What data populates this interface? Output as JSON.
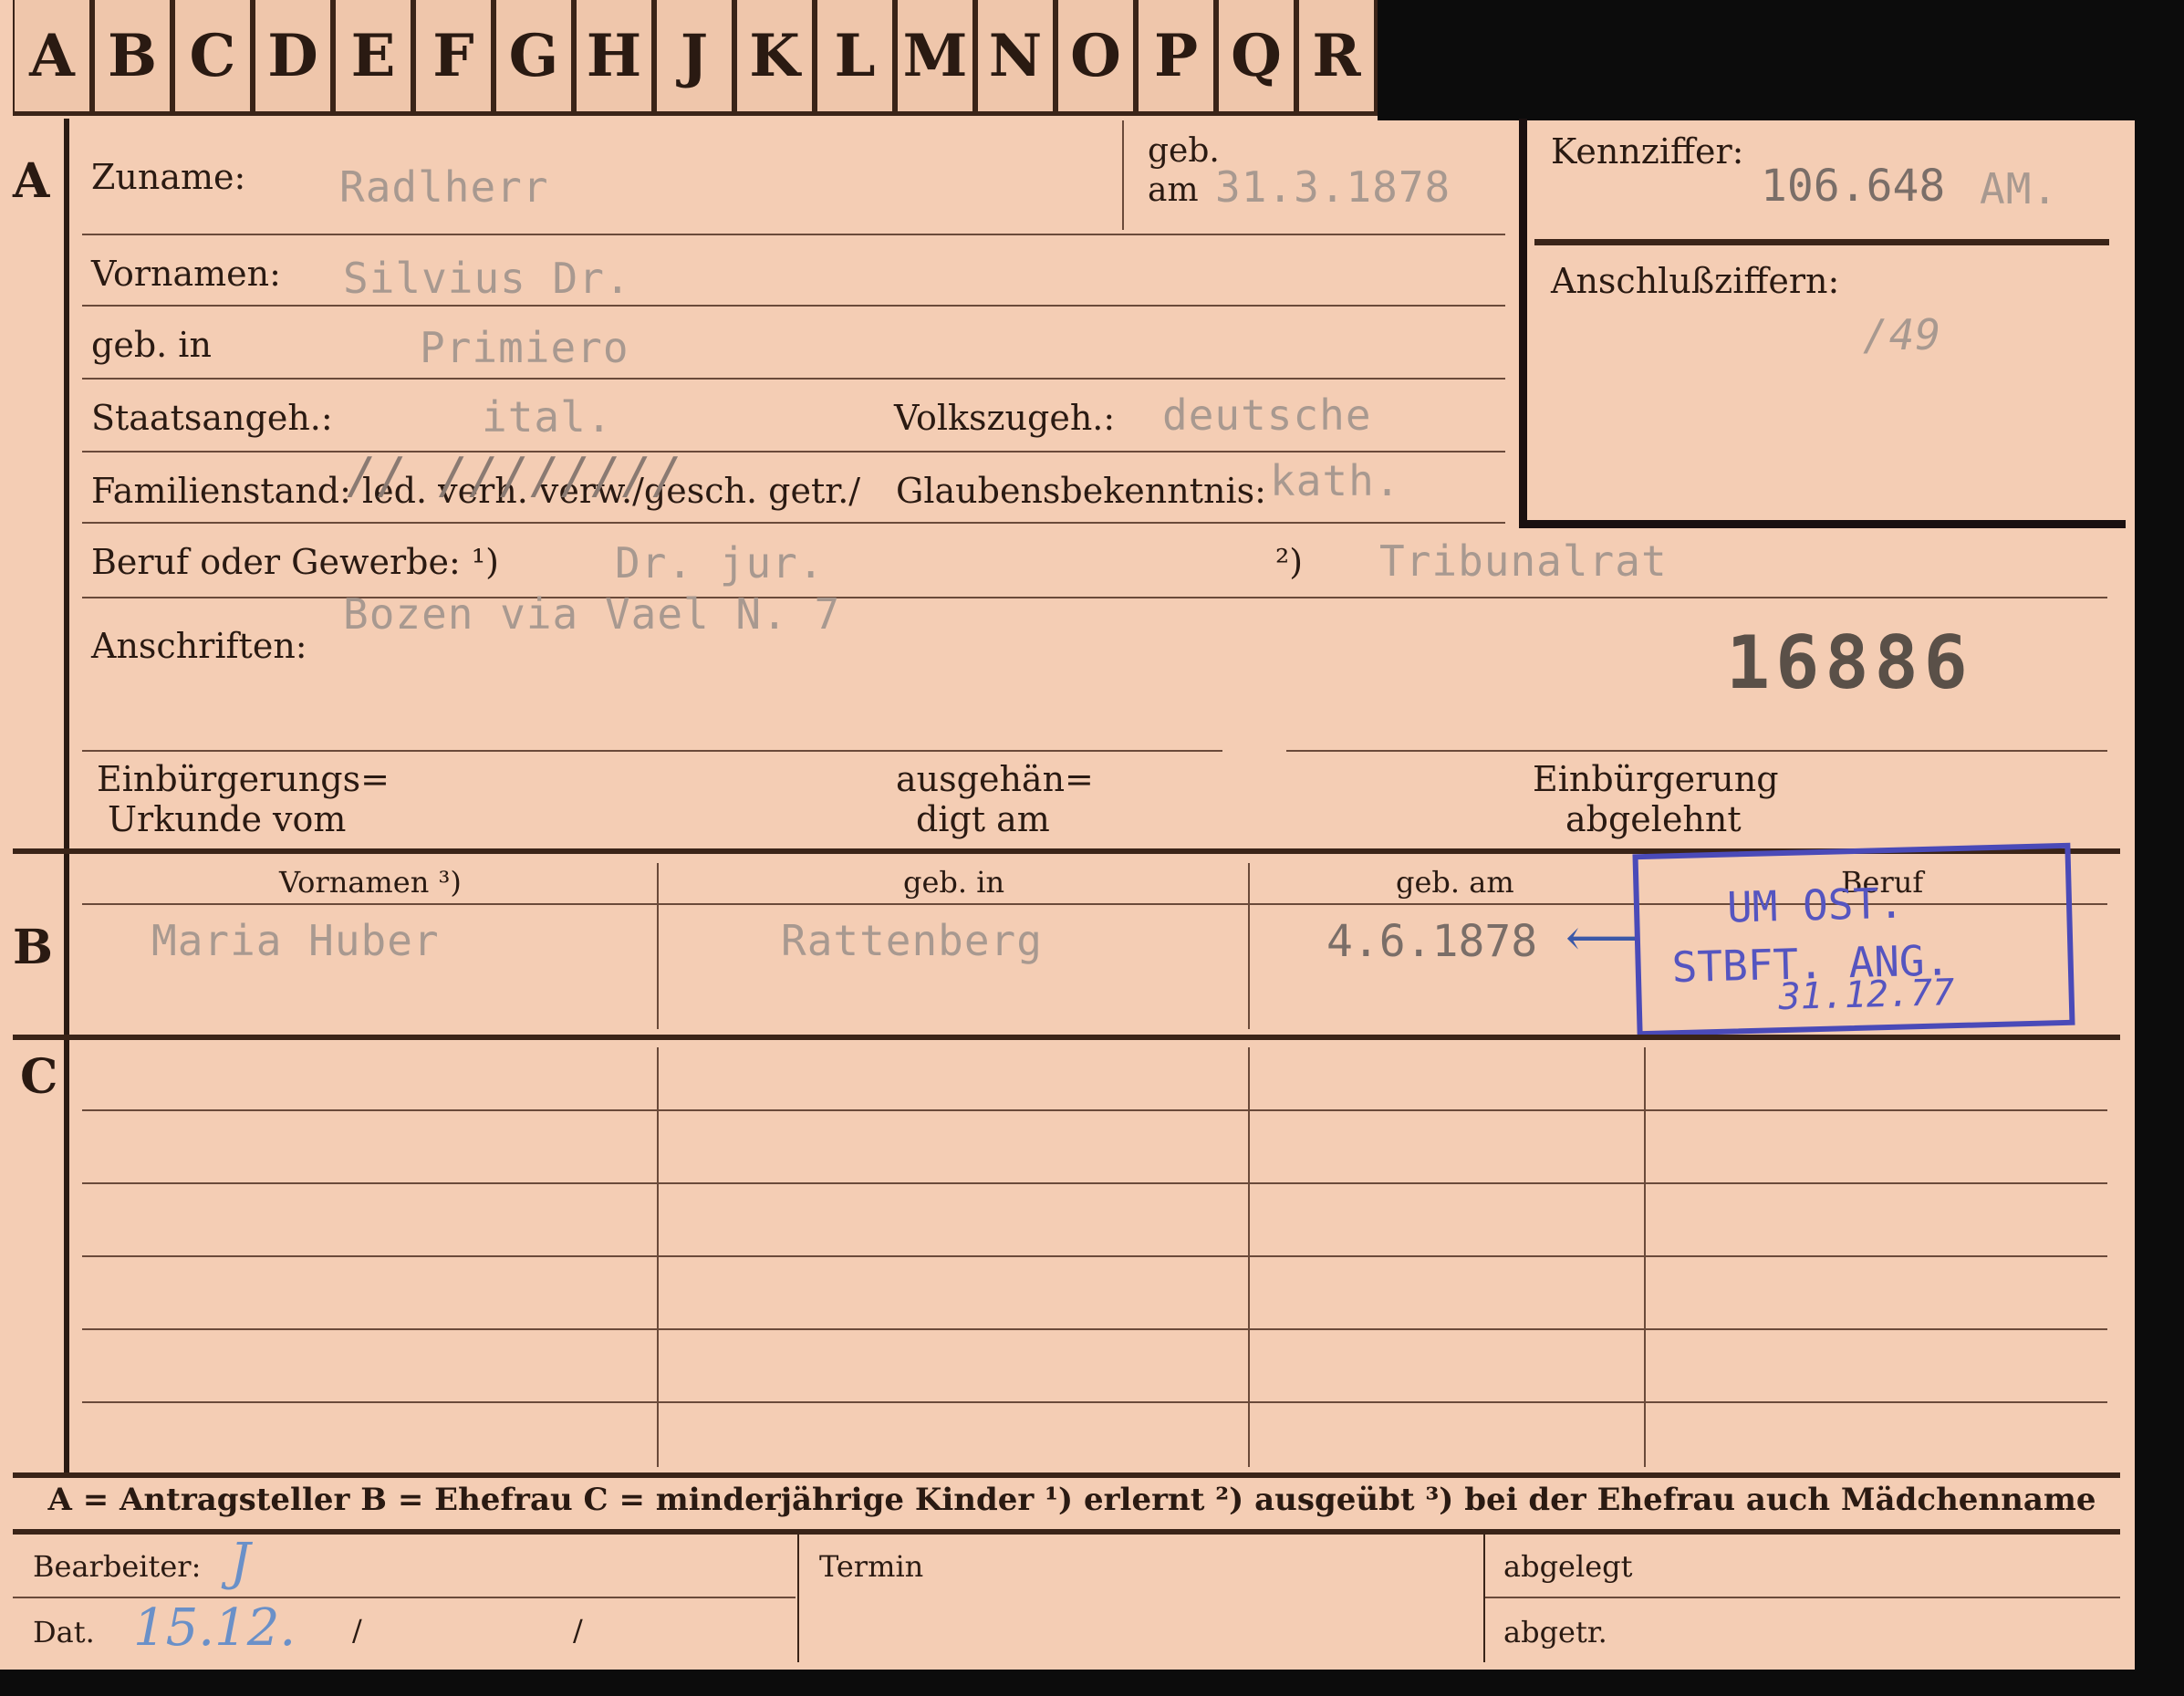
{
  "tabs": [
    "A",
    "B",
    "C",
    "D",
    "E",
    "F",
    "G",
    "H",
    "J",
    "K",
    "L",
    "M",
    "N",
    "O",
    "P",
    "Q",
    "R"
  ],
  "sections": {
    "a": "A",
    "b": "B",
    "c": "C"
  },
  "labels": {
    "zuname": "Zuname:",
    "geb_am_1": "geb.",
    "geb_am_2": "am",
    "kennziffer": "Kennziffer:",
    "anschluss": "Anschlußziffern:",
    "vornamen": "Vornamen:",
    "geb_in": "geb. in",
    "staatsangeh": "Staatsangeh.:",
    "volkszugeh": "Volkszugeh.:",
    "familienstand": "Familienstand: led. verh. verw./gesch. getr./",
    "glaubens": "Glaubensbekenntnis:",
    "beruf": "Beruf oder Gewerbe: ¹)",
    "beruf2": "²)",
    "anschriften": "Anschriften:",
    "einb_urkunde_1": "Einbürgerungs=",
    "einb_urkunde_2": "Urkunde vom",
    "ausgeh_1": "ausgehän=",
    "ausgeh_2": "digt am",
    "einb_abgelehnt_1": "Einbürgerung",
    "einb_abgelehnt_2": "abgelehnt",
    "b_vornamen": "Vornamen ³)",
    "b_geb_in": "geb. in",
    "b_geb_am": "geb. am",
    "b_beruf": "Beruf",
    "footnote": "A = Antragsteller   B = Ehefrau   C = minderjährige Kinder   ¹) erlernt   ²) ausgeübt   ³) bei der Ehefrau auch Mädchenname",
    "bearbeiter": "Bearbeiter:",
    "termin": "Termin",
    "abgelegt": "abgelegt",
    "dat": "Dat.",
    "abgetr": "abgetr."
  },
  "values": {
    "zuname": "Radlherr",
    "geb_am": "31.3.1878",
    "kennziffer": "106.648",
    "kennziffer_suffix": "AM.",
    "anschluss": "/49",
    "vornamen": "Silvius Dr.",
    "geb_in": "Primiero",
    "staatsangeh": "ital.",
    "volkszugeh": "deutsche",
    "glaubens": "kath.",
    "beruf1": "Dr. jur.",
    "beruf2": "Tribunalrat",
    "anschrift": "Bozen via Vael N. 7",
    "number": "16886",
    "b_vorname": "Maria Huber",
    "b_geb_in": "Rattenberg",
    "b_geb_am": "4.6.1878",
    "stamp_line1": "UM OST.",
    "stamp_line2": "STBFT. ANG.",
    "stamp_line3": "31.12.77",
    "bearbeiter": "J",
    "dat": "15.12.",
    "dat_sep1": "/",
    "dat_sep2": "/"
  },
  "colors": {
    "paper": "#f4cdb4",
    "ink": "#2a1a12",
    "stamp": "#4a4ab8",
    "pencil": "#6a90c8"
  }
}
